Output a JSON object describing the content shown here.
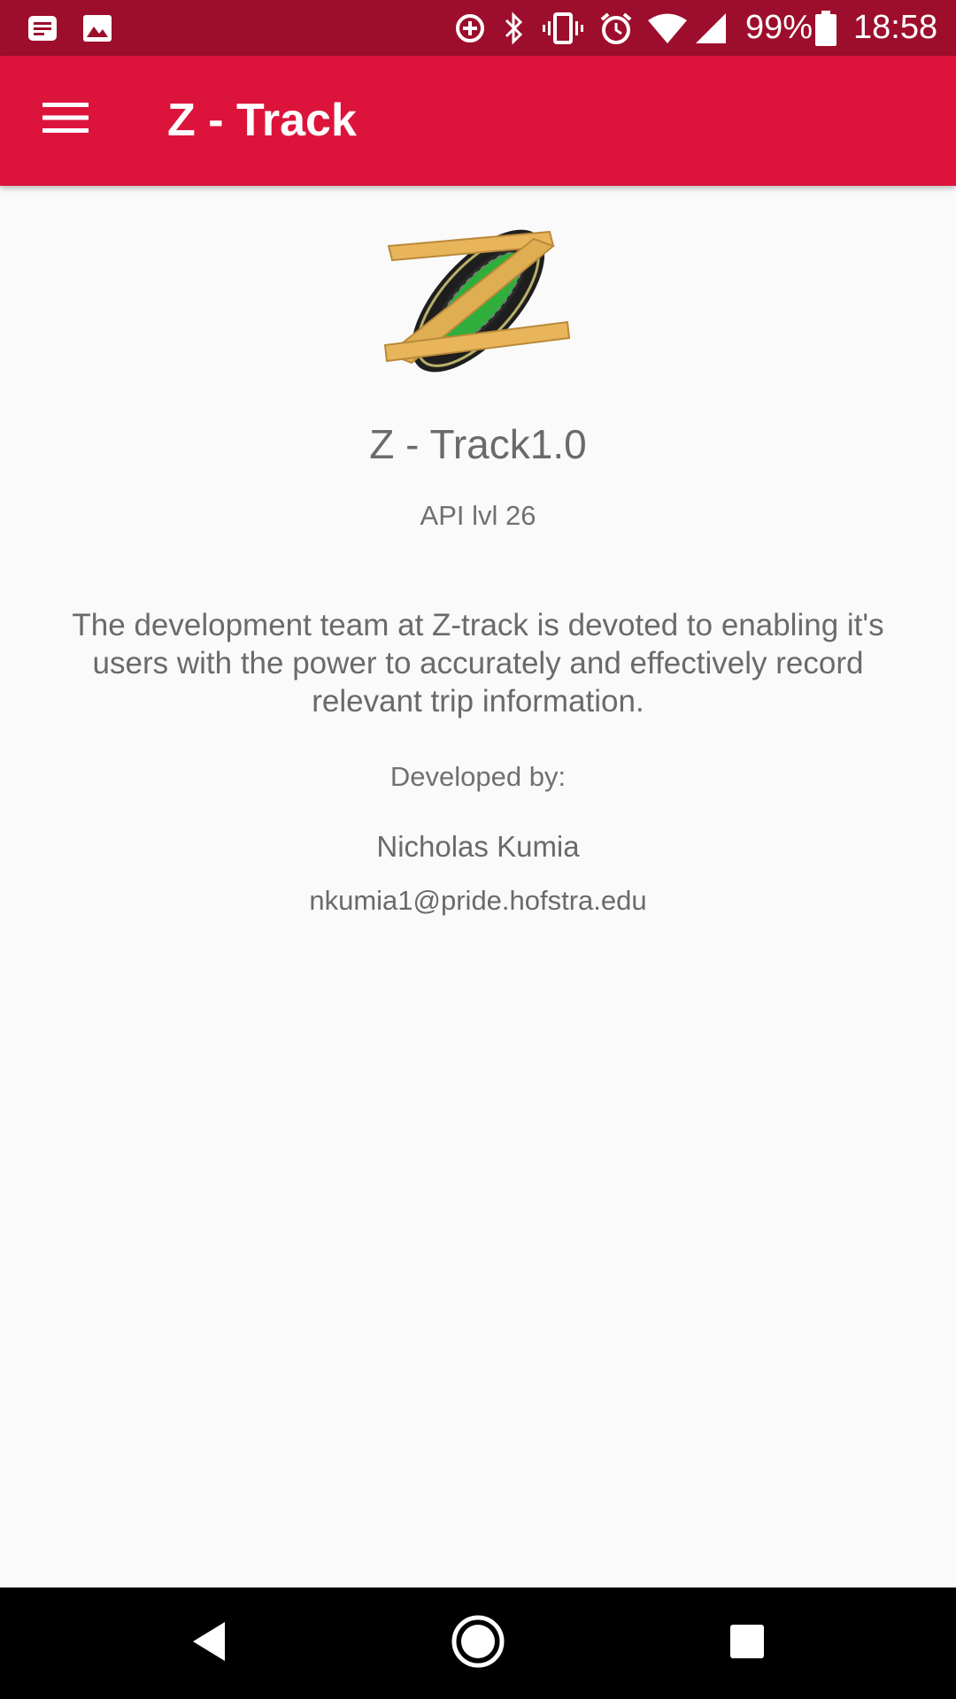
{
  "status_bar": {
    "battery": "99%",
    "time": "18:58",
    "icons": [
      "notification-icon",
      "image-icon",
      "data-saver-icon",
      "bluetooth-icon",
      "vibrate-icon",
      "alarm-icon",
      "wifi-icon",
      "signal-icon",
      "battery-icon"
    ]
  },
  "app_bar": {
    "title": "Z - Track",
    "menu_icon": "hamburger-menu-icon"
  },
  "about": {
    "app_name": "Z - Track1.0",
    "api_level": "API lvl 26",
    "description": "The development team at Z-track is devoted to enabling it's users with the power to accurately and effectively record relevant trip information.",
    "developed_by_label": "Developed by:",
    "developer_name": "Nicholas Kumia",
    "developer_email": "nkumia1@pride.hofstra.edu"
  },
  "nav_bar": {
    "back_icon": "back-triangle-icon",
    "home_icon": "home-circle-icon",
    "recents_icon": "recents-square-icon"
  },
  "colors": {
    "status_bar": "#9d0e2c",
    "app_bar": "#dc143c",
    "background": "#fafafa",
    "text": "#6a6a6a"
  }
}
